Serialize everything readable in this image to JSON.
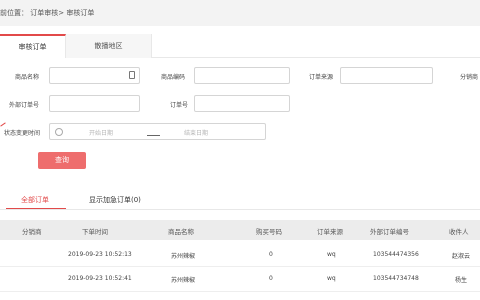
{
  "breadcrumb": "前位置： 订单审核> 审核订单",
  "tabs": [
    {
      "label": "审核订单"
    },
    {
      "label": "散播地区"
    }
  ],
  "form": {
    "product_name": "商品名称",
    "product_code": "商品编码",
    "order_source": "订单来源",
    "distributor": "分销商",
    "external_order_no": "外部订单号",
    "order_no": "订单号",
    "status_change_time": "状态变更时间",
    "start_placeholder": "开始日期",
    "end_placeholder": "结束日期",
    "query_button": "查询"
  },
  "order_tabs": [
    {
      "label": "全部订单"
    },
    {
      "label": "显示加急订单(0)"
    }
  ],
  "table": {
    "headers": [
      "分销商",
      "下单时间",
      "商品名称",
      "购买号码",
      "订单来源",
      "外部订单编号",
      "收件人"
    ],
    "rows": [
      {
        "distributor": "",
        "time": "2019-09-23 10:52:13",
        "product": "苏州辣椒",
        "number": "0",
        "source": "wq",
        "external_no": "103544474356",
        "receiver": "赵淑云"
      },
      {
        "distributor": "",
        "time": "2019-09-23 10:52:41",
        "product": "苏州辣椒",
        "number": "0",
        "source": "wq",
        "external_no": "103544734748",
        "receiver": "杨生"
      }
    ]
  },
  "colors": {
    "accent": "#e24a4a",
    "button": "#ee6d6d"
  }
}
